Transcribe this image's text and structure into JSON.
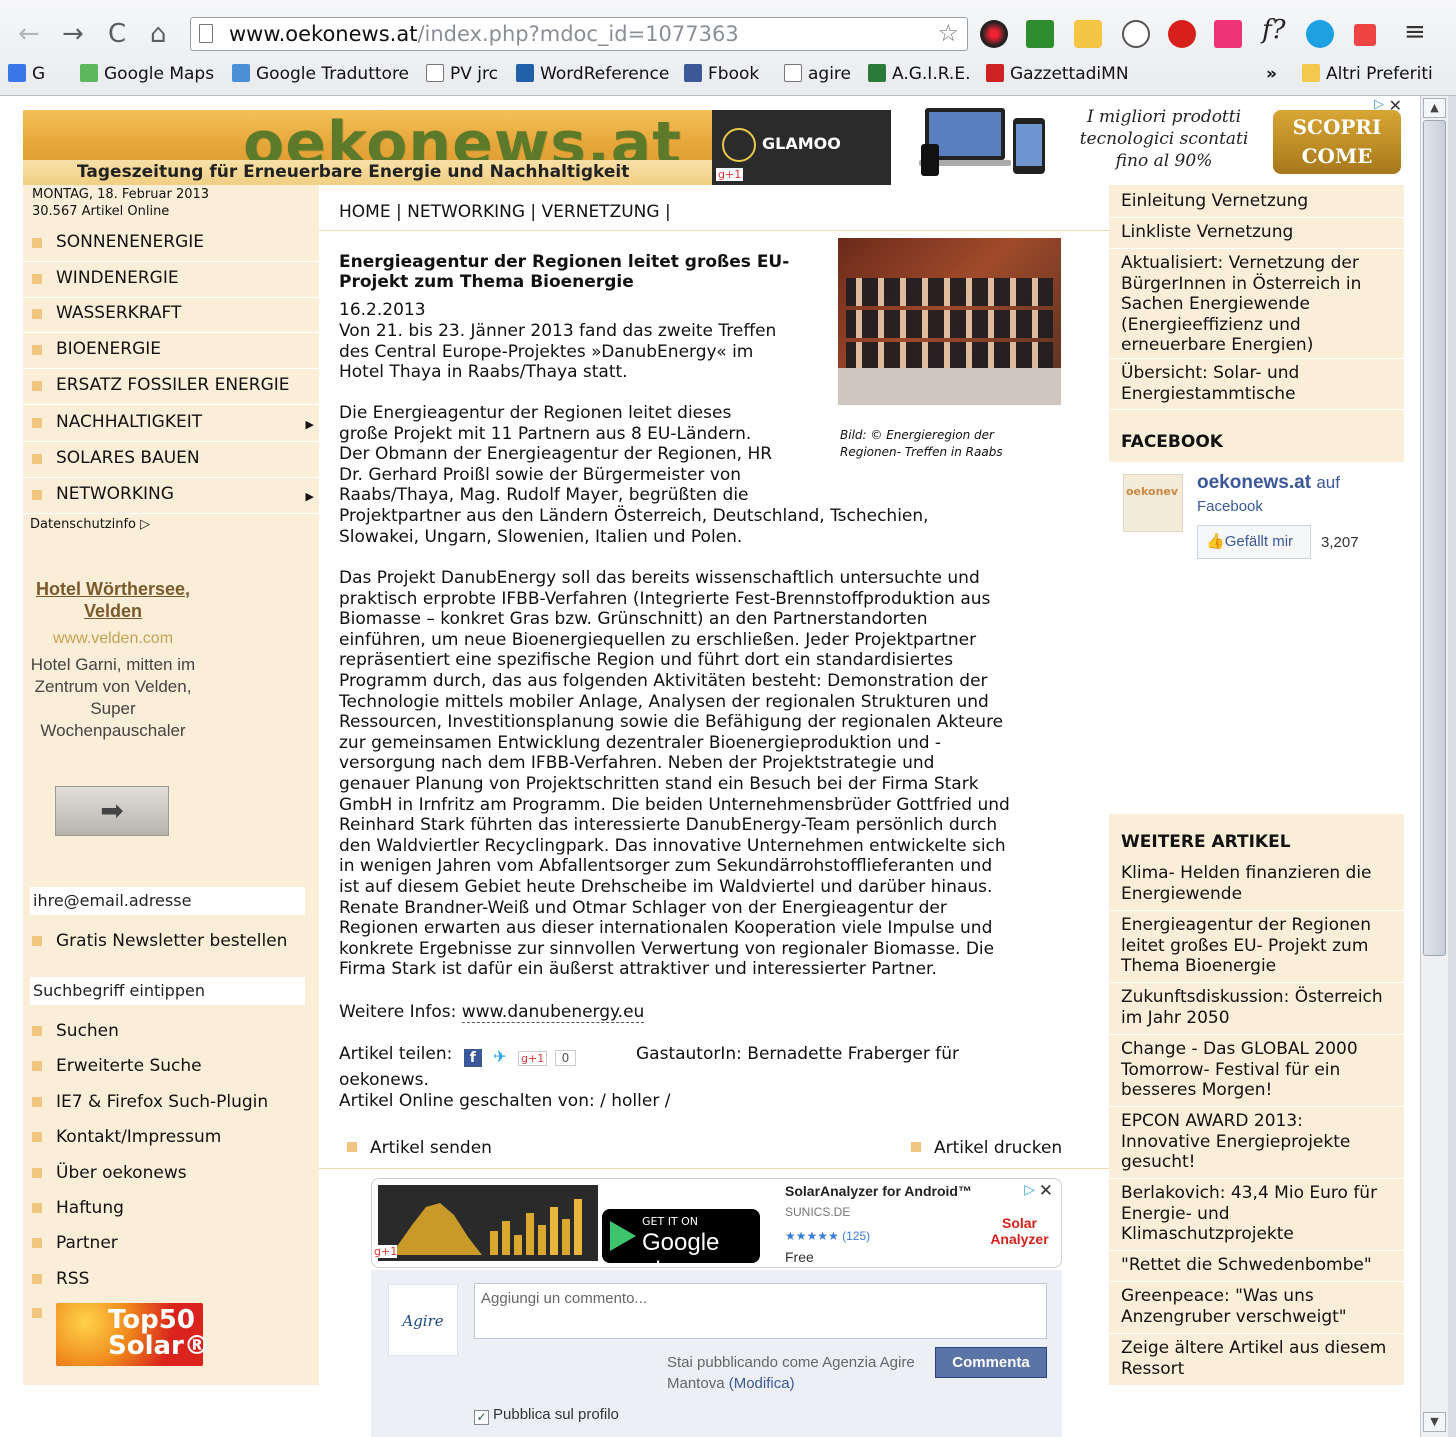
{
  "browser": {
    "url_host": "www.oekonews.at",
    "url_path": "/index.php?mdoc_id=1077363",
    "bookmarks": [
      "G",
      "Google Maps",
      "Google Traduttore",
      "PV jrc",
      "WordReference",
      "Fbook",
      "agire",
      "A.G.I.R.E.",
      "GazzettadiMN"
    ],
    "overflow": "»",
    "other_bookmarks": "Altri Preferiti"
  },
  "site": {
    "logo": "oekonews.at",
    "tagline": "Tageszeitung für Erneuerbare Energie und Nachhaltigkeit",
    "date": "MONTAG, 18. Februar 2013",
    "articles_online": "30.567 Artikel Online"
  },
  "ads": {
    "top_brand": "GLAMOO",
    "top_text": "I migliori prodotti tecnologici scontati fino al 90%",
    "top_cta": "SCOPRI COME",
    "gplus": "g+1",
    "bottom_title": "SolarAnalyzer for Android™",
    "bottom_domain": "SUNICS.DE",
    "bottom_rating": "★★★★★ (125)",
    "bottom_price": "Free",
    "bottom_getit": "GET IT ON",
    "bottom_googleplay": "Google play",
    "bottom_brand": "Solar Analyzer"
  },
  "leftnav": {
    "items": [
      "SONNENENERGIE",
      "WINDENERGIE",
      "WASSERKRAFT",
      "BIOENERGIE",
      "ERSATZ FOSSILER ENERGIE",
      "NACHHALTIGKEIT",
      "SOLARES BAUEN",
      "NETWORKING"
    ],
    "datenschutz": "Datenschutzinfo ▷"
  },
  "hotel": {
    "title": "Hotel Wörthersee, Velden",
    "url": "www.velden.com",
    "desc": "Hotel Garni, mitten im Zentrum von Velden, Super Wochenpauschaler"
  },
  "newsletter": {
    "email_placeholder": "ihre@email.adresse",
    "link": "Gratis Newsletter bestellen",
    "search_placeholder": "Suchbegriff eintippen"
  },
  "leftlinks": [
    "Suchen",
    "Erweiterte Suche",
    "IE7 & Firefox Such-Plugin",
    "Kontakt/Impressum",
    "Über oekonews",
    "Haftung",
    "Partner",
    "RSS"
  ],
  "top50": "Top50 Solar®",
  "breadcrumb": "HOME |  NETWORKING | VERNETZUNG |",
  "article": {
    "title": "Energieagentur der Regionen leitet großes EU-Projekt zum Thema Bioenergie",
    "date": "16.2.2013",
    "caption": "Bild: © Energieregion der Regionen- Treffen in Raabs",
    "p1": [
      "Von 21. bis 23. Jänner 2013 fand das zweite Treffen",
      "des Central Europe-Projektes »DanubEnergy« im",
      "Hotel Thaya in Raabs/Thaya statt."
    ],
    "p2": [
      "Die Energieagentur der Regionen leitet dieses",
      "große Projekt mit 11 Partnern aus 8 EU-Ländern.",
      "Der Obmann der Energieagentur der Regionen, HR",
      "Dr. Gerhard Proißl sowie der Bürgermeister von",
      "Raabs/Thaya, Mag. Rudolf Mayer, begrüßten die",
      "Projektpartner aus den Ländern Österreich, Deutschland, Tschechien,",
      "Slowakei, Ungarn, Slowenien, Italien und Polen."
    ],
    "p3": [
      "Das Projekt DanubEnergy soll das bereits wissenschaftlich untersuchte und",
      "praktisch erprobte IFBB-Verfahren (Integrierte Fest-Brennstoffproduktion aus",
      "Biomasse – konkret Gras bzw. Grünschnitt) an den Partnerstandorten",
      "einführen, um neue Bioenergiequellen zu erschließen. Jeder Projektpartner",
      "repräsentiert eine spezifische Region und führt dort ein standardisiertes",
      "Programm durch, das aus folgenden Aktivitäten besteht: Demonstration der",
      "Technologie mittels mobiler Anlage, Analysen der regionalen Strukturen und",
      "Ressourcen, Investitionsplanung sowie die Befähigung der regionalen Akteure",
      "zur gemeinsamen Entwicklung dezentraler Bioenergieproduktion und -",
      "versorgung nach dem IFBB-Verfahren. Neben der Projektstrategie und",
      "genauer Planung von Projektschritten stand ein Besuch bei der Firma Stark",
      "GmbH in Irnfritz am Programm. Die beiden Unternehmensbrüder Gottfried und",
      "Reinhard Stark führten das interessierte DanubEnergy-Team persönlich durch",
      "den Waldviertler Recyclingpark. Das innovative Unternehmen entwickelte sich",
      "in wenigen Jahren vom Abfallentsorger zum Sekundärrohstofflieferanten und",
      "ist auf diesem Gebiet heute Drehscheibe im Waldviertel und darüber hinaus.",
      "Renate Brandner-Weiß und Otmar Schlager von der Energieagentur der",
      "Regionen erwarten aus dieser internationalen Kooperation viele Impulse und",
      "konkrete Ergebnisse zur sinnvollen Verwertung von regionaler Biomasse. Die",
      "Firma Stark ist dafür ein äußerst attraktiver und interessierter Partner."
    ],
    "more_label": "Weitere Infos: ",
    "more_link": "www.danubenergy.eu",
    "share_label": "Artikel teilen:",
    "share_count": "0",
    "author_line1": "GastautorIn: Bernadette Fraberger für",
    "author_line2": "oekonews.",
    "online_by": "Artikel Online geschalten von: / holler /",
    "send": "Artikel senden",
    "print": "Artikel drucken"
  },
  "comments": {
    "logo_text": "Agire",
    "placeholder": "Aggiungi un commento...",
    "posting_as": "Stai pubblicando come Agenzia Agire Mantova",
    "modify": "(Modifica)",
    "button": "Commenta",
    "publish": "Pubblica sul profilo"
  },
  "right": {
    "top_links": [
      "Einleitung Vernetzung",
      "Linkliste Vernetzung",
      "Aktualisiert: Vernetzung der BürgerInnen in Österreich in Sachen Energiewende (Energieeffizienz und erneuerbare Energien)",
      "Übersicht: Solar- und Energiestammtische"
    ],
    "facebook_head": "FACEBOOK",
    "fb_logo": "oekonev",
    "fb_name": "oekonews.at",
    "fb_auf": "auf",
    "fb_sub": "Facebook",
    "fb_like": "Gefällt mir",
    "fb_count": "3,207",
    "weitere_head": "WEITERE ARTIKEL",
    "weitere": [
      "Klima- Helden finanzieren die Energiewende",
      "Energieagentur der Regionen leitet großes EU- Projekt zum Thema Bioenergie",
      "Zukunftsdiskussion: Österreich im Jahr 2050",
      "Change - Das GLOBAL 2000 Tomorrow- Festival für ein besseres Morgen!",
      "EPCON AWARD 2013: Innovative Energieprojekte gesucht!",
      "Berlakovich: 43,4 Mio Euro für Energie- und Klimaschutzprojekte",
      "\"Rettet die Schwedenbombe\"",
      "Greenpeace: \"Was uns Anzengruber verschweigt\"",
      "Zeige ältere Artikel aus diesem Ressort"
    ]
  }
}
